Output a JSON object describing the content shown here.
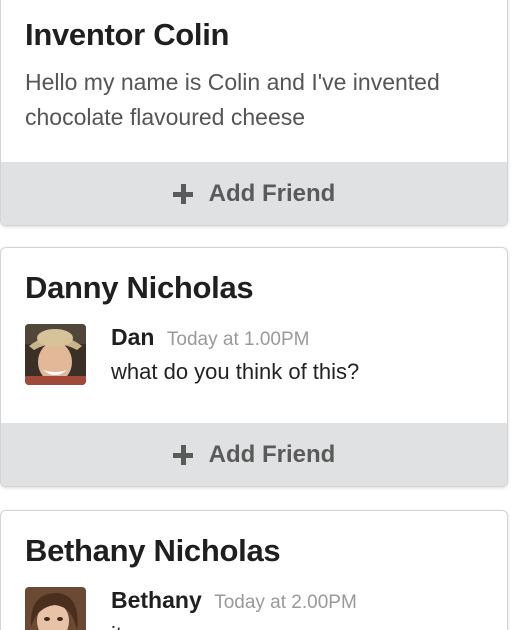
{
  "cards": [
    {
      "title": "Inventor Colin",
      "description": "Hello my name is Colin and I've invented chocolate flavoured cheese",
      "action_label": "Add Friend"
    },
    {
      "title": "Danny Nicholas",
      "comment": {
        "author": "Dan",
        "time": "Today at 1.00PM",
        "text": "what do you think of this?"
      },
      "action_label": "Add Friend"
    },
    {
      "title": "Bethany Nicholas",
      "comment": {
        "author": "Bethany",
        "time": "Today at 2.00PM",
        "text": "it"
      }
    }
  ],
  "icons": {
    "add": "plus-icon",
    "avatar": "user-photo"
  }
}
